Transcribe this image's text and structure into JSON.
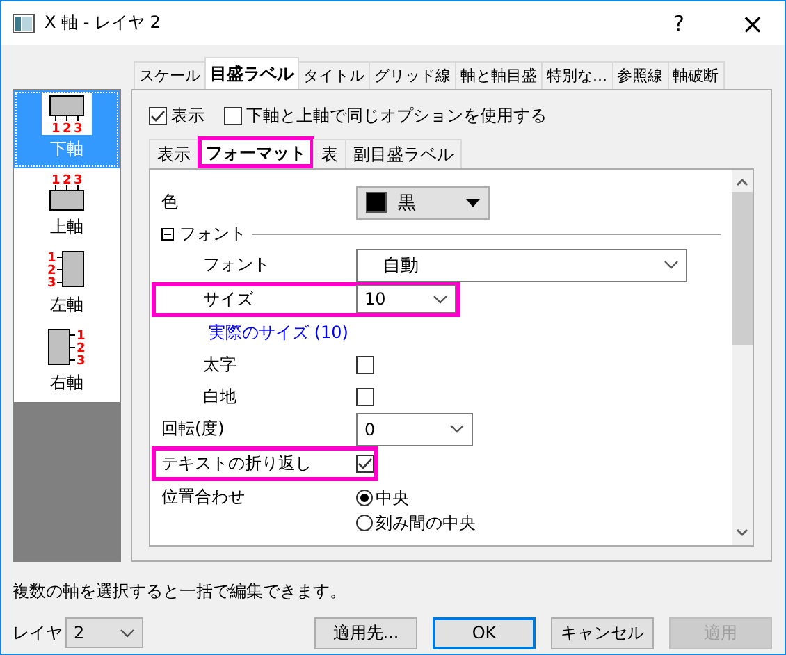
{
  "window": {
    "title": "X 軸 - レイヤ 2",
    "help": "?",
    "close": "×"
  },
  "axes": [
    {
      "kind": "bottom",
      "label": "下軸",
      "selected": true,
      "tick_labels": [
        "1",
        "2",
        "3"
      ]
    },
    {
      "kind": "top",
      "label": "上軸",
      "selected": false,
      "tick_labels": [
        "1",
        "2",
        "3"
      ]
    },
    {
      "kind": "left",
      "label": "左軸",
      "selected": false,
      "tick_labels": [
        "1",
        "2",
        "3"
      ]
    },
    {
      "kind": "right",
      "label": "右軸",
      "selected": false,
      "tick_labels": [
        "1",
        "2",
        "3"
      ]
    }
  ],
  "tabs": [
    {
      "label": "スケール",
      "selected": false
    },
    {
      "label": "目盛ラベル",
      "selected": true
    },
    {
      "label": "タイトル",
      "selected": false
    },
    {
      "label": "グリッド線",
      "selected": false
    },
    {
      "label": "軸と軸目盛",
      "selected": false
    },
    {
      "label": "特別な...",
      "selected": false
    },
    {
      "label": "参照線",
      "selected": false
    },
    {
      "label": "軸破断",
      "selected": false
    }
  ],
  "show": {
    "label": "表示",
    "checked": true
  },
  "same_options": {
    "label": "下軸と上軸で同じオプションを使用する",
    "checked": false
  },
  "subtabs": [
    {
      "label": "表示",
      "selected": false,
      "highlighted": false
    },
    {
      "label": "フォーマット",
      "selected": true,
      "highlighted": true
    },
    {
      "label": "表",
      "selected": false,
      "highlighted": false
    },
    {
      "label": "副目盛ラベル",
      "selected": false,
      "highlighted": false
    }
  ],
  "rows": [
    {
      "kind": "color",
      "label": "色",
      "value": "黒",
      "color": "#000000",
      "indent": false,
      "highlighted": false
    },
    {
      "kind": "group",
      "label": "フォント",
      "expanded": true
    },
    {
      "kind": "select",
      "label": "フォント",
      "value": "自動",
      "indent": true,
      "wide": true,
      "highlighted": false
    },
    {
      "kind": "select",
      "label": "サイズ",
      "value": "10",
      "indent": true,
      "wide": false,
      "highlighted": true
    },
    {
      "kind": "link",
      "label": "実際のサイズ (10)"
    },
    {
      "kind": "checkbox",
      "label": "太字",
      "checked": false,
      "indent": true,
      "highlighted": false
    },
    {
      "kind": "checkbox",
      "label": "白地",
      "checked": false,
      "indent": true,
      "highlighted": false
    },
    {
      "kind": "select",
      "label": "回転(度)",
      "value": "0",
      "indent": false,
      "wide": false,
      "highlighted": false
    },
    {
      "kind": "checkbox",
      "label": "テキストの折り返し",
      "checked": true,
      "indent": false,
      "highlighted": true
    },
    {
      "kind": "radio",
      "label": "位置合わせ",
      "options": [
        {
          "label": "中央",
          "selected": true
        },
        {
          "label": "刻み間の中央",
          "selected": false
        }
      ]
    }
  ],
  "hint": "複数の軸を選択すると一括で編集できます。",
  "layer": {
    "label": "レイヤ",
    "value": "2"
  },
  "buttons": [
    {
      "label": "適用先...",
      "default": false,
      "disabled": false
    },
    {
      "label": "OK",
      "default": true,
      "disabled": false
    },
    {
      "label": "キャンセル",
      "default": false,
      "disabled": false
    },
    {
      "label": "適用",
      "default": false,
      "disabled": true
    }
  ]
}
